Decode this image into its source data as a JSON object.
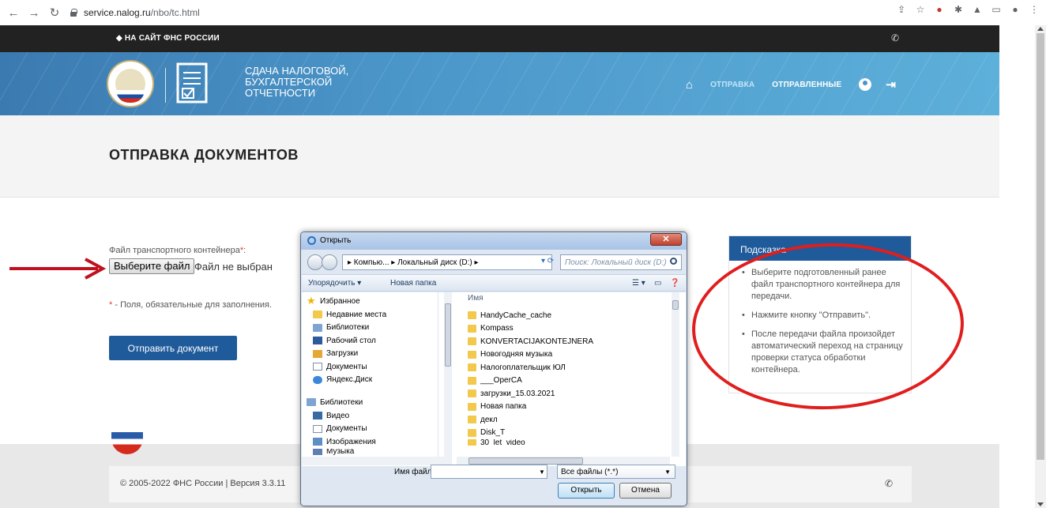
{
  "browser": {
    "url_host": "service.nalog.ru",
    "url_path": "/nbo/tc.html"
  },
  "topbar": {
    "back_link": "НА САЙТ ФНС РОССИИ"
  },
  "header": {
    "title_lines": [
      "СДАЧА НАЛОГОВОЙ,",
      "БУХГАЛТЕРСКОЙ",
      "ОТЧЕТНОСТИ"
    ],
    "nav": {
      "send": "ОТПРАВКА",
      "sent": "ОТПРАВЛЕННЫЕ"
    }
  },
  "page": {
    "title": "ОТПРАВКА ДОКУМЕНТОВ"
  },
  "form": {
    "file_label": "Файл транспортного контейнера",
    "required_mark": "*",
    "file_label_suffix": ":",
    "choose_file": "Выберите файл",
    "file_status": "Файл не выбран",
    "required_note": "- Поля, обязательные для заполнения.",
    "submit": "Отправить документ"
  },
  "hint": {
    "title": "Подсказка",
    "items": [
      "Выберите подготовленный ранее файл транспортного контейнера для передачи.",
      "Нажмите кнопку \"Отправить\".",
      "После передачи файла произойдет автоматический переход на страницу проверки статуса обработки контейнера."
    ]
  },
  "footer": {
    "copyright": "© 2005-2022 ФНС России   |   Версия 3.3.11"
  },
  "dialog": {
    "title": "Открыть",
    "breadcrumb": "▸ Компью... ▸ Локальный диск (D:) ▸",
    "search_placeholder": "Поиск: Локальный диск (D:)",
    "toolbar": {
      "organize": "Упорядочить ▾",
      "new_folder": "Новая папка"
    },
    "nav_favorites": {
      "header": "Избранное",
      "items": [
        "Недавние места",
        "Библиотеки",
        "Рабочий стол",
        "Загрузки",
        "Документы",
        "Яндекс.Диск"
      ]
    },
    "nav_libraries": {
      "header": "Библиотеки",
      "items": [
        "Видео",
        "Документы",
        "Изображения",
        "Музыка"
      ]
    },
    "column_name": "Имя",
    "files": [
      "HandyCache_cache",
      "Kompass",
      "KONVERTACIJAKONTEJNERA",
      "Новогодняя музыка",
      "Налогоплательщик ЮЛ",
      "___OperCA",
      "загрузки_15.03.2021",
      "Новая папка",
      "декл",
      "Disk_T",
      "30_let_video"
    ],
    "filename_label": "Имя файла:",
    "filetype": "Все файлы (*.*)",
    "open_button": "Открыть",
    "cancel_button": "Отмена"
  }
}
